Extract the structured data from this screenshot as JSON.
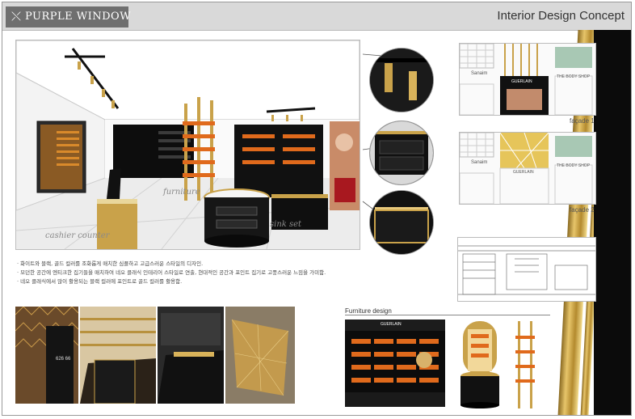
{
  "header": {
    "logo_text": "PURPLE WINDOW",
    "title": "Interior Design Concept"
  },
  "render": {
    "labels": {
      "furniture": "furniture",
      "cashier": "cashier counter",
      "sink": "sink set"
    }
  },
  "facades": [
    {
      "caption": "façade 1",
      "brand_left": "Sanaim",
      "brand_center": "GUERLAIN",
      "brand_right": "THE BODY SHOP"
    },
    {
      "caption": "façade 2",
      "brand_left": "Sanaim",
      "brand_center": "GUERLAIN",
      "brand_right": "THE BODY SHOP"
    }
  ],
  "notes": [
    "· 화이트와 블랙, 골드 컬러를 조화롭게 매치한 심플하고 고급스러운 스타일의 디자인.",
    "· 모던한 공간에 엔티크한 집기들을 매치하여 네오 클래식 인테리어 스타일로 연출, 현대적인 공간과 포인트 집기로 고풍스러운 느낌을 가미함.",
    "· 네오 클래식에서 많이 활용되는 블랙 컬러에 포인트로 골드 컬러를 활용함."
  ],
  "photo_labels": {
    "door_sign": "626 66"
  },
  "furniture": {
    "title": "Furniture design",
    "cabinet_brand": "GUERLAIN"
  },
  "colors": {
    "gold": "#c9a24a",
    "black": "#0b0b0b",
    "header_bg": "#d9d9d9"
  }
}
